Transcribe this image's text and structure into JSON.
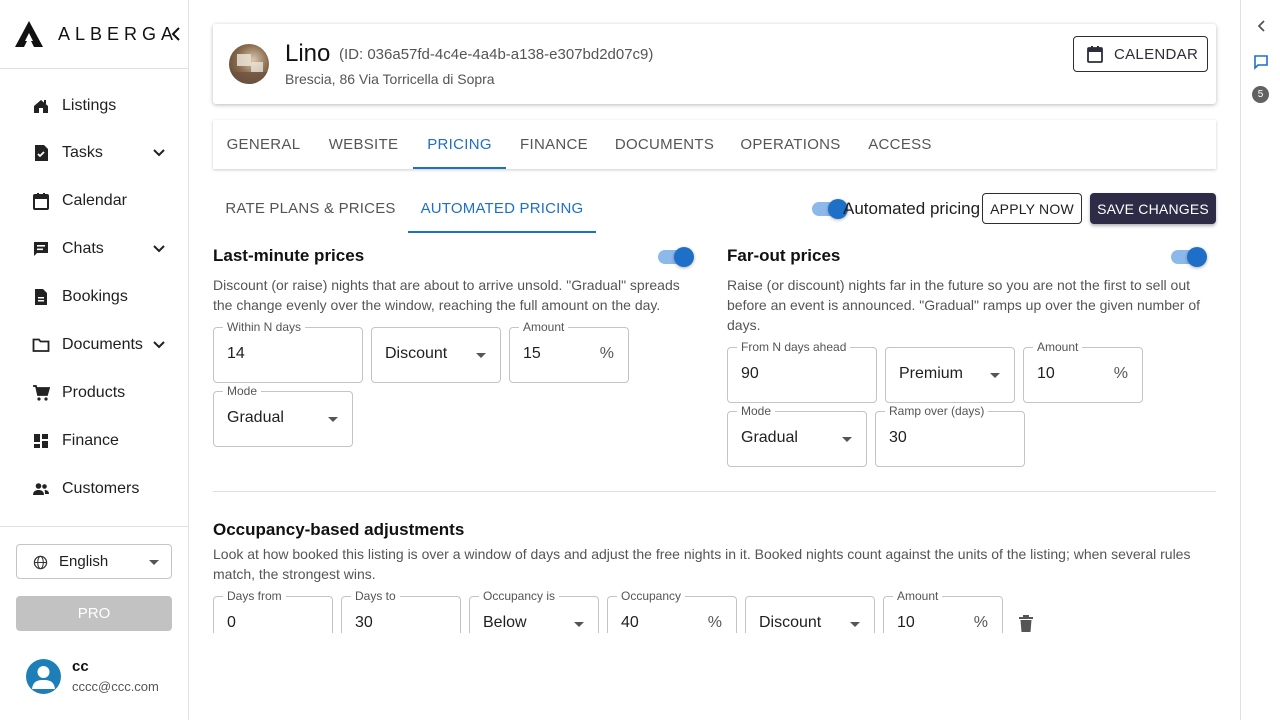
{
  "brand": {
    "name": "ALBERGA"
  },
  "sidebar": {
    "items": [
      {
        "label": "Listings",
        "icon": "house-icon"
      },
      {
        "label": "Tasks",
        "icon": "task-icon",
        "expandable": true
      },
      {
        "label": "Calendar",
        "icon": "calendar-icon"
      },
      {
        "label": "Chats",
        "icon": "chat-icon",
        "expandable": true
      },
      {
        "label": "Bookings",
        "icon": "document-icon"
      },
      {
        "label": "Documents",
        "icon": "folder-icon",
        "expandable": true
      },
      {
        "label": "Products",
        "icon": "cart-icon"
      },
      {
        "label": "Finance",
        "icon": "dashboard-icon"
      },
      {
        "label": "Customers",
        "icon": "people-icon"
      }
    ],
    "language": "English",
    "pro_label": "PRO",
    "user": {
      "name": "cc",
      "email": "cccc@ccc.com"
    }
  },
  "rail": {
    "badge": "5"
  },
  "header": {
    "name": "Lino",
    "id_text": "(ID: 036a57fd-4c4e-4a4b-a138-e307bd2d07c9)",
    "address": "Brescia, 86 Via Torricella di Sopra",
    "calendar_label": "CALENDAR"
  },
  "tabs": [
    "GENERAL",
    "WEBSITE",
    "PRICING",
    "FINANCE",
    "DOCUMENTS",
    "OPERATIONS",
    "ACCESS"
  ],
  "active_tab": "PRICING",
  "subtabs": [
    "RATE PLANS & PRICES",
    "AUTOMATED PRICING"
  ],
  "active_subtab": "AUTOMATED PRICING",
  "automated_pricing": {
    "label": "Automated pricing",
    "enabled": true
  },
  "actions": {
    "apply": "APPLY NOW",
    "save": "SAVE CHANGES"
  },
  "last_minute": {
    "title": "Last-minute prices",
    "enabled": true,
    "description": "Discount (or raise) nights that are about to arrive unsold. \"Gradual\" spreads the change evenly over the window, reaching the full amount on the day.",
    "within_label": "Within N days",
    "within_value": "14",
    "type_value": "Discount",
    "amount_label": "Amount",
    "amount_value": "15",
    "amount_suffix": "%",
    "mode_label": "Mode",
    "mode_value": "Gradual"
  },
  "far_out": {
    "title": "Far-out prices",
    "enabled": true,
    "description": "Raise (or discount) nights far in the future so you are not the first to sell out before an event is announced. \"Gradual\" ramps up over the given number of days.",
    "from_label": "From N days ahead",
    "from_value": "90",
    "type_value": "Premium",
    "amount_label": "Amount",
    "amount_value": "10",
    "amount_suffix": "%",
    "mode_label": "Mode",
    "mode_value": "Gradual",
    "ramp_label": "Ramp over (days)",
    "ramp_value": "30"
  },
  "occupancy": {
    "title": "Occupancy-based adjustments",
    "description": "Look at how booked this listing is over a window of days and adjust the free nights in it. Booked nights count against the units of the listing; when several rules match, the strongest wins.",
    "rule": {
      "days_from_label": "Days from",
      "days_from": "0",
      "days_to_label": "Days to",
      "days_to": "30",
      "occ_is_label": "Occupancy is",
      "occ_is": "Below",
      "occ_label": "Occupancy",
      "occ_value": "40",
      "occ_suffix": "%",
      "type_value": "Discount",
      "amount_label": "Amount",
      "amount_value": "10",
      "amount_suffix": "%"
    }
  },
  "colors": {
    "accent": "#1e6fc8",
    "dark": "#2c2c46",
    "pro_disabled": "#c2c2c2",
    "avatar": "#1e7fb8"
  }
}
